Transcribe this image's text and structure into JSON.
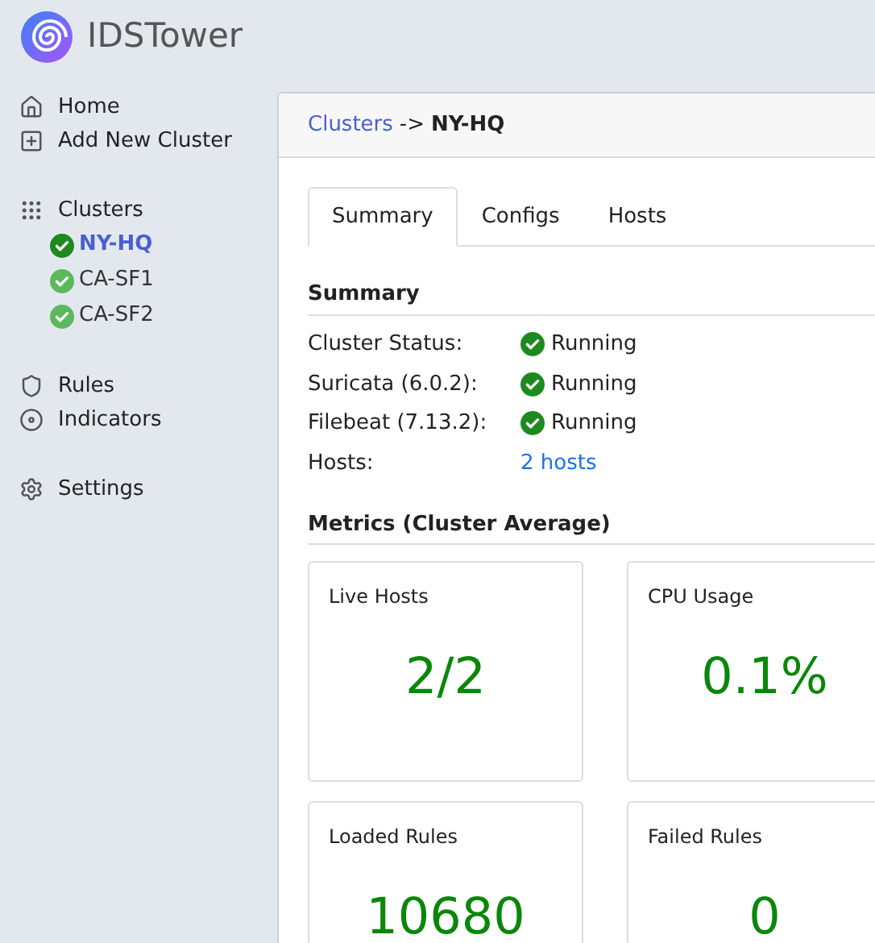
{
  "brand": {
    "name": "IDSTower"
  },
  "sidebar": {
    "sections": [
      {
        "items": [
          {
            "label": "Home"
          },
          {
            "label": "Add New Cluster"
          }
        ]
      },
      {
        "items": [
          {
            "label": "Clusters",
            "children": [
              {
                "label": "NY-HQ",
                "selected": true
              },
              {
                "label": "CA-SF1",
                "selected": false
              },
              {
                "label": "CA-SF2",
                "selected": false
              }
            ]
          }
        ]
      },
      {
        "items": [
          {
            "label": "Rules"
          },
          {
            "label": "Indicators"
          }
        ]
      },
      {
        "items": [
          {
            "label": "Settings"
          }
        ]
      }
    ]
  },
  "breadcrumb": {
    "link": "Clusters",
    "separator": "->",
    "current": "NY-HQ"
  },
  "tabs": [
    {
      "label": "Summary",
      "selected": true
    },
    {
      "label": "Configs",
      "selected": false
    },
    {
      "label": "Hosts",
      "selected": false
    }
  ],
  "summary": {
    "title": "Summary",
    "rows": [
      {
        "kind": "status",
        "label": "Cluster Status:",
        "value": "Running"
      },
      {
        "kind": "status",
        "label": "Suricata (6.0.2):",
        "value": "Running"
      },
      {
        "kind": "status",
        "label": "Filebeat (7.13.2):",
        "value": "Running"
      },
      {
        "kind": "link",
        "label": "Hosts:",
        "value": "2 hosts"
      }
    ]
  },
  "metrics": {
    "title": "Metrics (Cluster Average)",
    "cards": [
      {
        "label": "Live Hosts",
        "value": "2/2"
      },
      {
        "label": "CPU Usage",
        "value": "0.1%"
      },
      {
        "label": "Loaded Rules",
        "value": "10680"
      },
      {
        "label": "Failed Rules",
        "value": "0"
      }
    ]
  }
}
